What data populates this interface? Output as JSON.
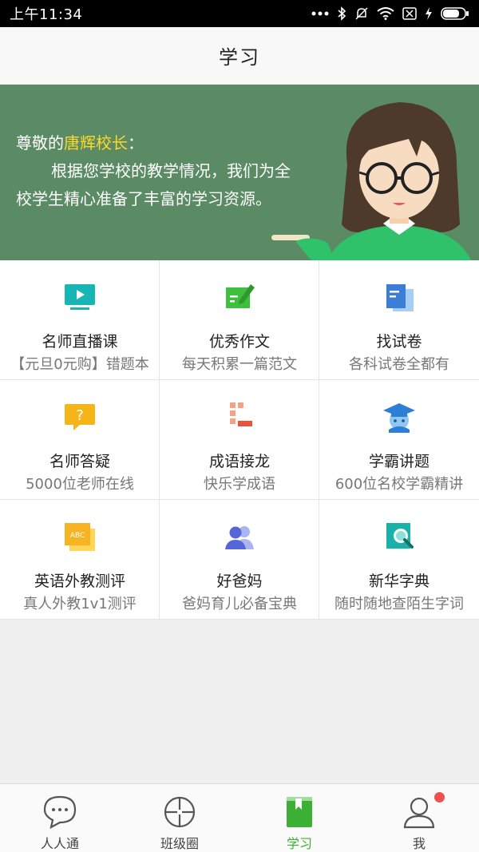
{
  "status_bar": {
    "time": "上午11:34"
  },
  "nav": {
    "title": "学习"
  },
  "banner": {
    "greeting_prefix": "尊敬的",
    "principal_name": "唐辉校长",
    "greeting_suffix": "：",
    "line1": "根据您学校的教学情况，我们为全",
    "line2": "校学生精心准备了丰富的学习资源。"
  },
  "grid": [
    {
      "title": "名师直播课",
      "subtitle": "【元旦0元购】错题本",
      "icon": "video-icon"
    },
    {
      "title": "优秀作文",
      "subtitle": "每天积累一篇范文",
      "icon": "composition-icon"
    },
    {
      "title": "找试卷",
      "subtitle": "各科试卷全都有",
      "icon": "exam-paper-icon"
    },
    {
      "title": "名师答疑",
      "subtitle": "5000位老师在线",
      "icon": "question-icon"
    },
    {
      "title": "成语接龙",
      "subtitle": "快乐学成语",
      "icon": "idiom-chain-icon"
    },
    {
      "title": "学霸讲题",
      "subtitle": "600位名校学霸精讲",
      "icon": "graduation-cap-icon"
    },
    {
      "title": "英语外教测评",
      "subtitle": "真人外教1v1测评",
      "icon": "abc-icon",
      "icon_text": "ABC"
    },
    {
      "title": "好爸妈",
      "subtitle": "爸妈育儿必备宝典",
      "icon": "parents-icon"
    },
    {
      "title": "新华字典",
      "subtitle": "随时随地查陌生字词",
      "icon": "dictionary-icon"
    }
  ],
  "tabs": [
    {
      "label": "人人通",
      "icon": "chat-bubble-icon",
      "active": false
    },
    {
      "label": "班级圈",
      "icon": "aperture-icon",
      "active": false
    },
    {
      "label": "学习",
      "icon": "book-icon",
      "active": true
    },
    {
      "label": "我",
      "icon": "person-icon",
      "active": false
    }
  ],
  "colors": {
    "banner_bg": "#5b8b64",
    "highlight_name": "#ffd829",
    "active_tab": "#3cb035",
    "badge": "#f05050"
  }
}
